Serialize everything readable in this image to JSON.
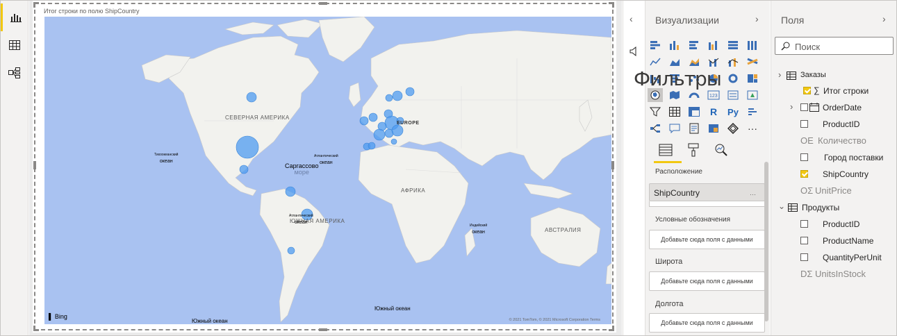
{
  "visual": {
    "title": "Итог строки по полю ShipCountry",
    "labels": {
      "north_america": "СЕВЕРНАЯ АМЕРИКА",
      "europe": "EUROPE",
      "africa": "АФРИКА",
      "south_america": "ЮЖНАЯ АМЕРИКА",
      "australia": "АВСТРАЛИЯ",
      "sargasso": "Саргассово",
      "sargasso_sub": "море",
      "pacific_1": "Тихоокеанский",
      "pacific_1b": "океан",
      "atlantic_1": "Атлантический",
      "atlantic_1b": "океан",
      "atlantic_2": "Атлантический",
      "atlantic_2b": "океан",
      "indian": "Индийский",
      "indian_b": "океан",
      "southern_1": "Южный океан",
      "southern_2": "Южный океан"
    },
    "bing": "Bing",
    "copyright": "© 2021 TomTom, © 2021 Microsoft Corporation Terms"
  },
  "filters_label": "Фильтры",
  "viz_pane": {
    "title": "Визуализации",
    "sections": {
      "location": "Расположение",
      "legend": "Условные обозначения",
      "latitude": "Широта",
      "longitude": "Долгота"
    },
    "location_value": "ShipCountry",
    "placeholder": "Добавьте сюда поля с данными"
  },
  "fields_pane": {
    "title": "Поля",
    "search_placeholder": "Поиск",
    "tables": [
      {
        "name": "Заказы",
        "fields": [
          {
            "label": "Итог строки",
            "checked": true,
            "sigma": true
          },
          {
            "label": "OrderDate",
            "checked": false,
            "expandable": true
          },
          {
            "label": "ProductID",
            "checked": false
          },
          {
            "label": "Количество",
            "checked": false,
            "ghost": true,
            "prefix": "ОЕ "
          },
          {
            "label": "Город поставки",
            "checked": false
          },
          {
            "label": "ShipCountry",
            "checked": true
          },
          {
            "label": "UnitPrice",
            "checked": false,
            "ghost": true,
            "prefix": "ОΣ "
          }
        ]
      },
      {
        "name": "Продукты",
        "fields": [
          {
            "label": "ProductID",
            "checked": false
          },
          {
            "label": "ProductName",
            "checked": false
          },
          {
            "label": "QuantityPerUnit",
            "checked": false
          },
          {
            "label": "UnitsInStock",
            "checked": false,
            "ghost": true,
            "prefix": "DΣ "
          }
        ]
      }
    ]
  },
  "colors": {
    "accent": "#f2c811",
    "ocean": "#a9c2f1",
    "land": "#f2f2ee",
    "bubble": "#4d9bf0"
  }
}
